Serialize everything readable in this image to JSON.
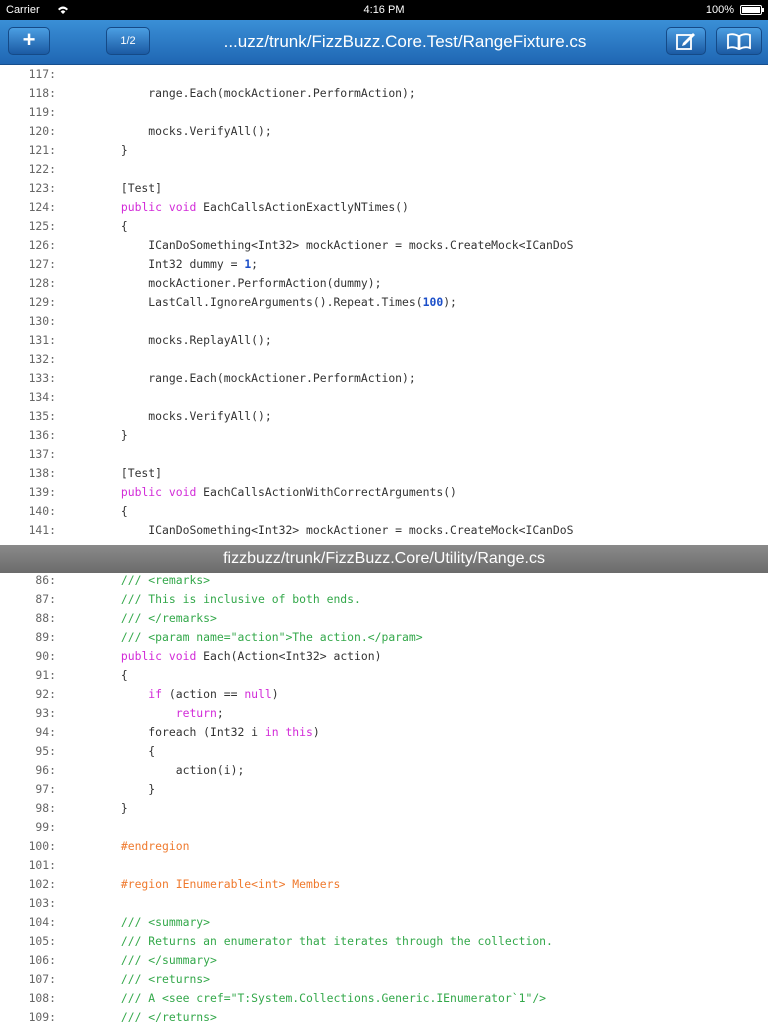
{
  "status_bar": {
    "carrier": "Carrier",
    "time": "4:16 PM",
    "battery": "100%"
  },
  "toolbar": {
    "add_label": "+",
    "page_label": "1/2",
    "title": "...uzz/trunk/FizzBuzz.Core.Test/RangeFixture.cs",
    "edit_icon": "edit-icon",
    "book_icon": "book-icon"
  },
  "divider": {
    "title": "fizzbuzz/trunk/FizzBuzz.Core/Utility/Range.cs"
  },
  "colors": {
    "toolbar_top": "#3a8fd6",
    "toolbar_bottom": "#1f66b3",
    "keyword": "#d22ad8",
    "comment": "#33a84a",
    "preprocessor": "#ef7a2e",
    "number": "#1c4fc9",
    "divider": "#7a7a7a"
  },
  "top_pane": {
    "lines": [
      {
        "num": "117:",
        "tokens": []
      },
      {
        "num": "118:",
        "tokens": [
          {
            "t": "            range.Each(mockActioner.PerformAction);",
            "c": "plain"
          }
        ]
      },
      {
        "num": "119:",
        "tokens": []
      },
      {
        "num": "120:",
        "tokens": [
          {
            "t": "            mocks.VerifyAll();",
            "c": "plain"
          }
        ]
      },
      {
        "num": "121:",
        "tokens": [
          {
            "t": "        }",
            "c": "plain"
          }
        ]
      },
      {
        "num": "122:",
        "tokens": []
      },
      {
        "num": "123:",
        "tokens": [
          {
            "t": "        [Test]",
            "c": "plain"
          }
        ]
      },
      {
        "num": "124:",
        "tokens": [
          {
            "t": "        ",
            "c": "plain"
          },
          {
            "t": "public void",
            "c": "kw"
          },
          {
            "t": " EachCallsActionExactlyNTimes()",
            "c": "plain"
          }
        ]
      },
      {
        "num": "125:",
        "tokens": [
          {
            "t": "        {",
            "c": "plain"
          }
        ]
      },
      {
        "num": "126:",
        "tokens": [
          {
            "t": "            ICanDoSomething<Int32> mockActioner = mocks.CreateMock<ICanDoS",
            "c": "plain"
          }
        ]
      },
      {
        "num": "127:",
        "tokens": [
          {
            "t": "            Int32 dummy = ",
            "c": "plain"
          },
          {
            "t": "1",
            "c": "nm"
          },
          {
            "t": ";",
            "c": "plain"
          }
        ]
      },
      {
        "num": "128:",
        "tokens": [
          {
            "t": "            mockActioner.PerformAction(dummy);",
            "c": "plain"
          }
        ]
      },
      {
        "num": "129:",
        "tokens": [
          {
            "t": "            LastCall.IgnoreArguments().Repeat.Times(",
            "c": "plain"
          },
          {
            "t": "100",
            "c": "nm"
          },
          {
            "t": ");",
            "c": "plain"
          }
        ]
      },
      {
        "num": "130:",
        "tokens": []
      },
      {
        "num": "131:",
        "tokens": [
          {
            "t": "            mocks.ReplayAll();",
            "c": "plain"
          }
        ]
      },
      {
        "num": "132:",
        "tokens": []
      },
      {
        "num": "133:",
        "tokens": [
          {
            "t": "            range.Each(mockActioner.PerformAction);",
            "c": "plain"
          }
        ]
      },
      {
        "num": "134:",
        "tokens": []
      },
      {
        "num": "135:",
        "tokens": [
          {
            "t": "            mocks.VerifyAll();",
            "c": "plain"
          }
        ]
      },
      {
        "num": "136:",
        "tokens": [
          {
            "t": "        }",
            "c": "plain"
          }
        ]
      },
      {
        "num": "137:",
        "tokens": []
      },
      {
        "num": "138:",
        "tokens": [
          {
            "t": "        [Test]",
            "c": "plain"
          }
        ]
      },
      {
        "num": "139:",
        "tokens": [
          {
            "t": "        ",
            "c": "plain"
          },
          {
            "t": "public void",
            "c": "kw"
          },
          {
            "t": " EachCallsActionWithCorrectArguments()",
            "c": "plain"
          }
        ]
      },
      {
        "num": "140:",
        "tokens": [
          {
            "t": "        {",
            "c": "plain"
          }
        ]
      },
      {
        "num": "141:",
        "tokens": [
          {
            "t": "            ICanDoSomething<Int32> mockActioner = mocks.CreateMock<ICanDoS",
            "c": "plain"
          }
        ]
      }
    ]
  },
  "bottom_pane": {
    "lines": [
      {
        "num": "86:",
        "tokens": [
          {
            "t": "        /// <remarks>",
            "c": "cm"
          }
        ]
      },
      {
        "num": "87:",
        "tokens": [
          {
            "t": "        /// This is inclusive of both ends.",
            "c": "cm"
          }
        ]
      },
      {
        "num": "88:",
        "tokens": [
          {
            "t": "        /// </remarks>",
            "c": "cm"
          }
        ]
      },
      {
        "num": "89:",
        "tokens": [
          {
            "t": "        /// <param name=\"action\">The action.</param>",
            "c": "cm"
          }
        ]
      },
      {
        "num": "90:",
        "tokens": [
          {
            "t": "        ",
            "c": "plain"
          },
          {
            "t": "public void",
            "c": "kw"
          },
          {
            "t": " Each(Action<Int32> action)",
            "c": "plain"
          }
        ]
      },
      {
        "num": "91:",
        "tokens": [
          {
            "t": "        {",
            "c": "plain"
          }
        ]
      },
      {
        "num": "92:",
        "tokens": [
          {
            "t": "            ",
            "c": "plain"
          },
          {
            "t": "if",
            "c": "kw"
          },
          {
            "t": " (action == ",
            "c": "plain"
          },
          {
            "t": "null",
            "c": "kw"
          },
          {
            "t": ")",
            "c": "plain"
          }
        ]
      },
      {
        "num": "93:",
        "tokens": [
          {
            "t": "                ",
            "c": "plain"
          },
          {
            "t": "return",
            "c": "kw"
          },
          {
            "t": ";",
            "c": "plain"
          }
        ]
      },
      {
        "num": "94:",
        "tokens": [
          {
            "t": "            foreach (Int32 i ",
            "c": "plain"
          },
          {
            "t": "in this",
            "c": "kw"
          },
          {
            "t": ")",
            "c": "plain"
          }
        ]
      },
      {
        "num": "95:",
        "tokens": [
          {
            "t": "            {",
            "c": "plain"
          }
        ]
      },
      {
        "num": "96:",
        "tokens": [
          {
            "t": "                action(i);",
            "c": "plain"
          }
        ]
      },
      {
        "num": "97:",
        "tokens": [
          {
            "t": "            }",
            "c": "plain"
          }
        ]
      },
      {
        "num": "98:",
        "tokens": [
          {
            "t": "        }",
            "c": "plain"
          }
        ]
      },
      {
        "num": "99:",
        "tokens": []
      },
      {
        "num": "100:",
        "tokens": [
          {
            "t": "        #endregion",
            "c": "pp"
          }
        ]
      },
      {
        "num": "101:",
        "tokens": []
      },
      {
        "num": "102:",
        "tokens": [
          {
            "t": "        #region IEnumerable<int> Members",
            "c": "pp"
          }
        ]
      },
      {
        "num": "103:",
        "tokens": []
      },
      {
        "num": "104:",
        "tokens": [
          {
            "t": "        /// <summary>",
            "c": "cm"
          }
        ]
      },
      {
        "num": "105:",
        "tokens": [
          {
            "t": "        /// Returns an enumerator that iterates through the collection.",
            "c": "cm"
          }
        ]
      },
      {
        "num": "106:",
        "tokens": [
          {
            "t": "        /// </summary>",
            "c": "cm"
          }
        ]
      },
      {
        "num": "107:",
        "tokens": [
          {
            "t": "        /// <returns>",
            "c": "cm"
          }
        ]
      },
      {
        "num": "108:",
        "tokens": [
          {
            "t": "        /// A <see cref=\"T:System.Collections.Generic.IEnumerator`1\"/> ",
            "c": "cm"
          }
        ]
      },
      {
        "num": "109:",
        "tokens": [
          {
            "t": "        /// </returns>",
            "c": "cm"
          }
        ]
      }
    ]
  }
}
